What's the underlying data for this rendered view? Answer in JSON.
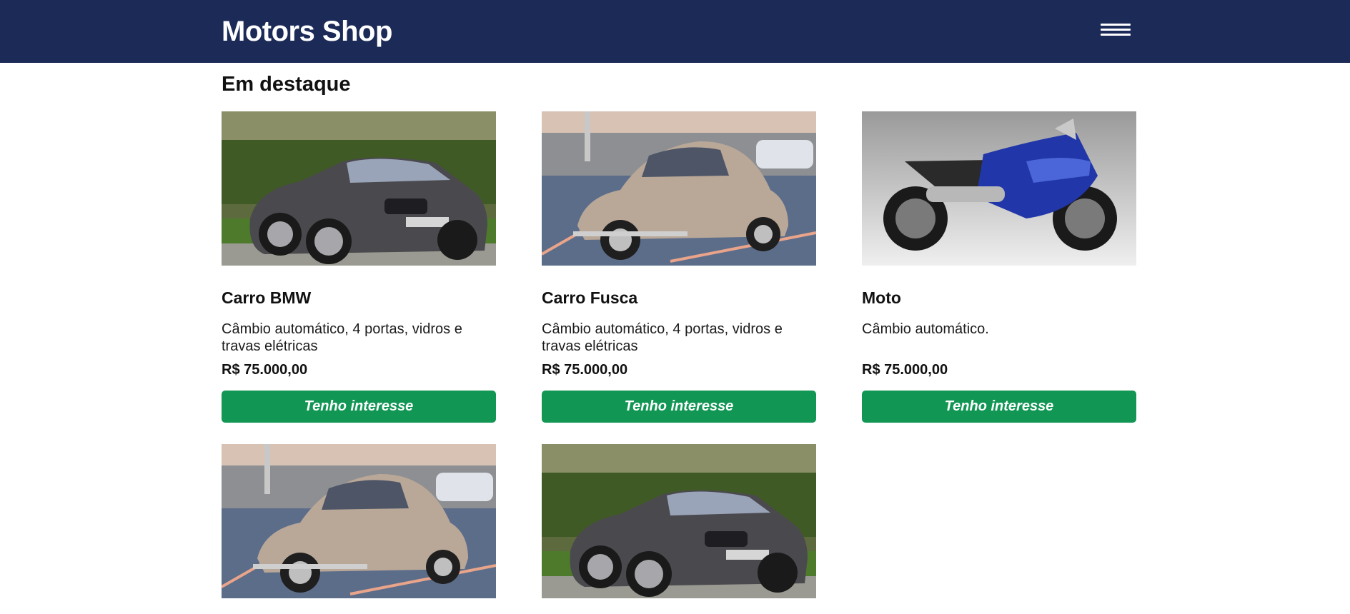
{
  "header": {
    "brand": "Motors Shop",
    "menu_icon": "hamburger-menu-icon"
  },
  "featured": {
    "title": "Em destaque",
    "cards": [
      {
        "image": "gray-bmw-convertible",
        "title": "Carro BMW",
        "description": "Câmbio automático, 4 portas, vidros e travas elétricas",
        "price": "R$ 75.000,00",
        "cta": "Tenho interesse"
      },
      {
        "image": "beige-vw-beetle",
        "title": "Carro Fusca",
        "description": "Câmbio automático, 4 portas, vidros e travas elétricas",
        "price": "R$ 75.000,00",
        "cta": "Tenho interesse"
      },
      {
        "image": "blue-sport-motorcycle",
        "title": "Moto",
        "description": "Câmbio automático.",
        "price": "R$ 75.000,00",
        "cta": "Tenho interesse"
      },
      {
        "image": "beige-vw-beetle"
      },
      {
        "image": "gray-bmw-convertible"
      }
    ]
  },
  "colors": {
    "header_bg": "#1b2a57",
    "button_bg": "#119654",
    "button_text": "#ffffff"
  }
}
